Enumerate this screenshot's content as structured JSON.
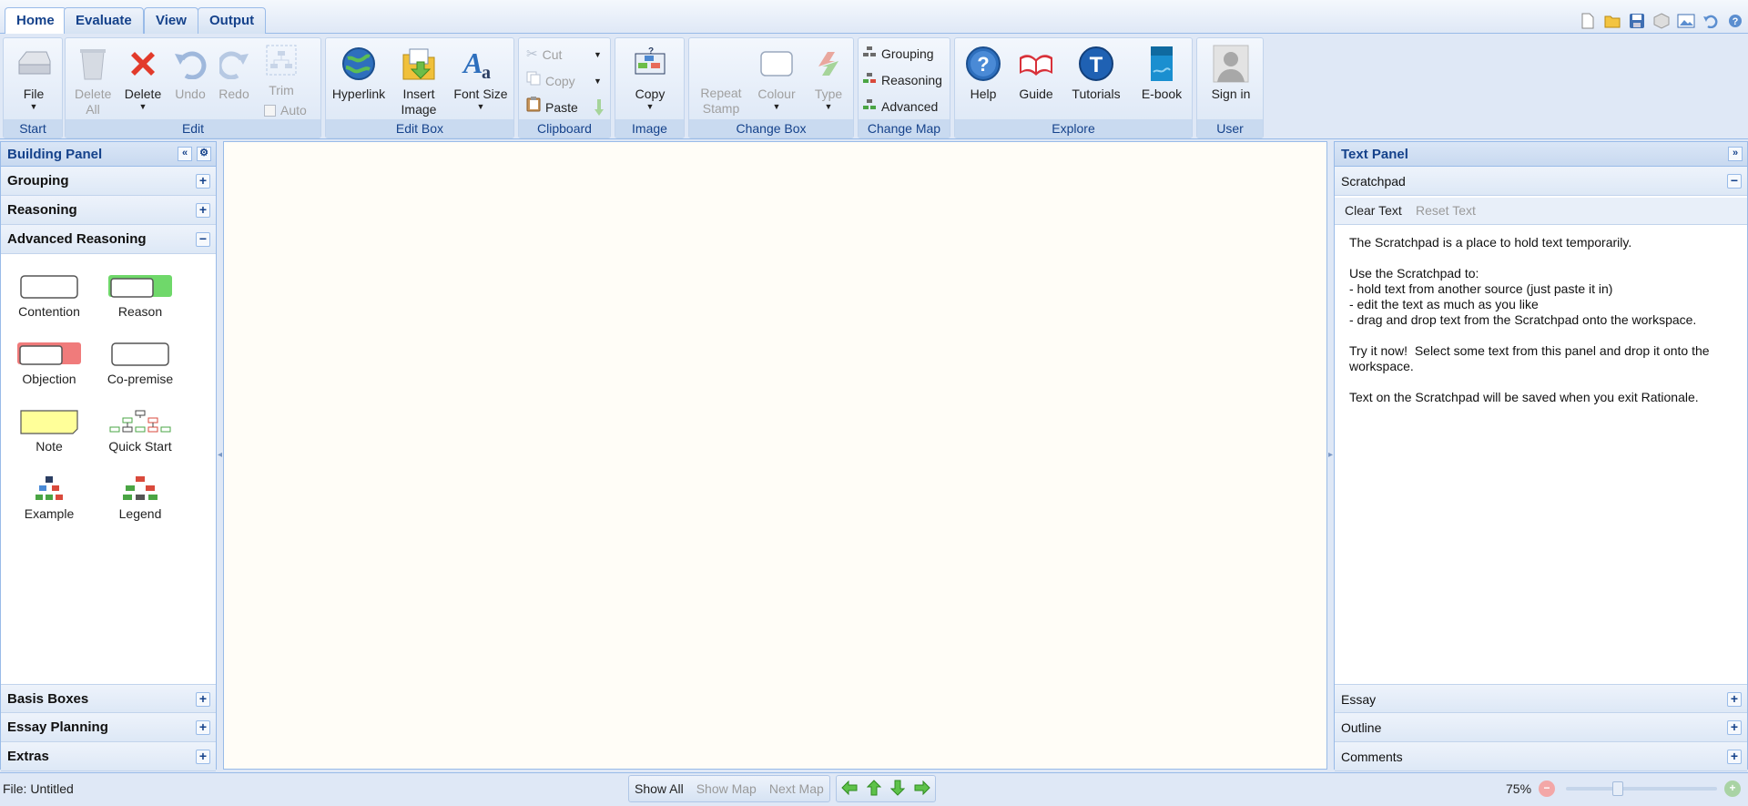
{
  "tabs": [
    "Home",
    "Evaluate",
    "View",
    "Output"
  ],
  "quick_access_icons": [
    "new-file-icon",
    "open-folder-icon",
    "save-icon",
    "cube-icon",
    "image-icon",
    "undo-icon",
    "help-icon"
  ],
  "ribbon": {
    "start": {
      "label": "Start",
      "file": "File"
    },
    "edit": {
      "label": "Edit",
      "delete_all": "Delete All",
      "delete": "Delete",
      "undo": "Undo",
      "redo": "Redo",
      "trim": "Trim",
      "auto": "Auto"
    },
    "edit_box": {
      "label": "Edit Box",
      "hyperlink": "Hyperlink",
      "insert_image": "Insert Image",
      "font_size": "Font Size"
    },
    "clipboard": {
      "label": "Clipboard",
      "cut": "Cut",
      "copy": "Copy",
      "paste": "Paste"
    },
    "image": {
      "label": "Image",
      "copy": "Copy"
    },
    "change_box": {
      "label": "Change Box",
      "repeat_stamp": "Repeat Stamp",
      "colour": "Colour",
      "type": "Type"
    },
    "change_map": {
      "label": "Change Map",
      "grouping": "Grouping",
      "reasoning": "Reasoning",
      "advanced": "Advanced"
    },
    "explore": {
      "label": "Explore",
      "help": "Help",
      "guide": "Guide",
      "tutorials": "Tutorials",
      "ebook": "E-book"
    },
    "user": {
      "label": "User",
      "sign_in": "Sign in"
    }
  },
  "building_panel": {
    "title": "Building Panel",
    "sections_top": [
      "Grouping",
      "Reasoning",
      "Advanced Reasoning"
    ],
    "tools": [
      "Contention",
      "Reason",
      "Objection",
      "Co-premise",
      "Note",
      "Quick Start",
      "Example",
      "Legend"
    ],
    "sections_bottom": [
      "Basis Boxes",
      "Essay Planning",
      "Extras"
    ]
  },
  "text_panel": {
    "title": "Text Panel",
    "scratchpad": "Scratchpad",
    "clear_text": "Clear Text",
    "reset_text": "Reset Text",
    "content": "The Scratchpad is a place to hold text temporarily.\n\nUse the Scratchpad to:\n- hold text from another source (just paste it in)\n- edit the text as much as you like\n- drag and drop text from the Scratchpad onto the workspace.\n\nTry it now!  Select some text from this panel and drop it onto the workspace.\n\nText on the Scratchpad will be saved when you exit Rationale.",
    "sections_bottom": [
      "Essay",
      "Outline",
      "Comments"
    ]
  },
  "status": {
    "file": "File: Untitled",
    "show_all": "Show All",
    "show_map": "Show Map",
    "next_map": "Next Map",
    "zoom": "75%",
    "zoom_level_fraction": 0.33
  }
}
